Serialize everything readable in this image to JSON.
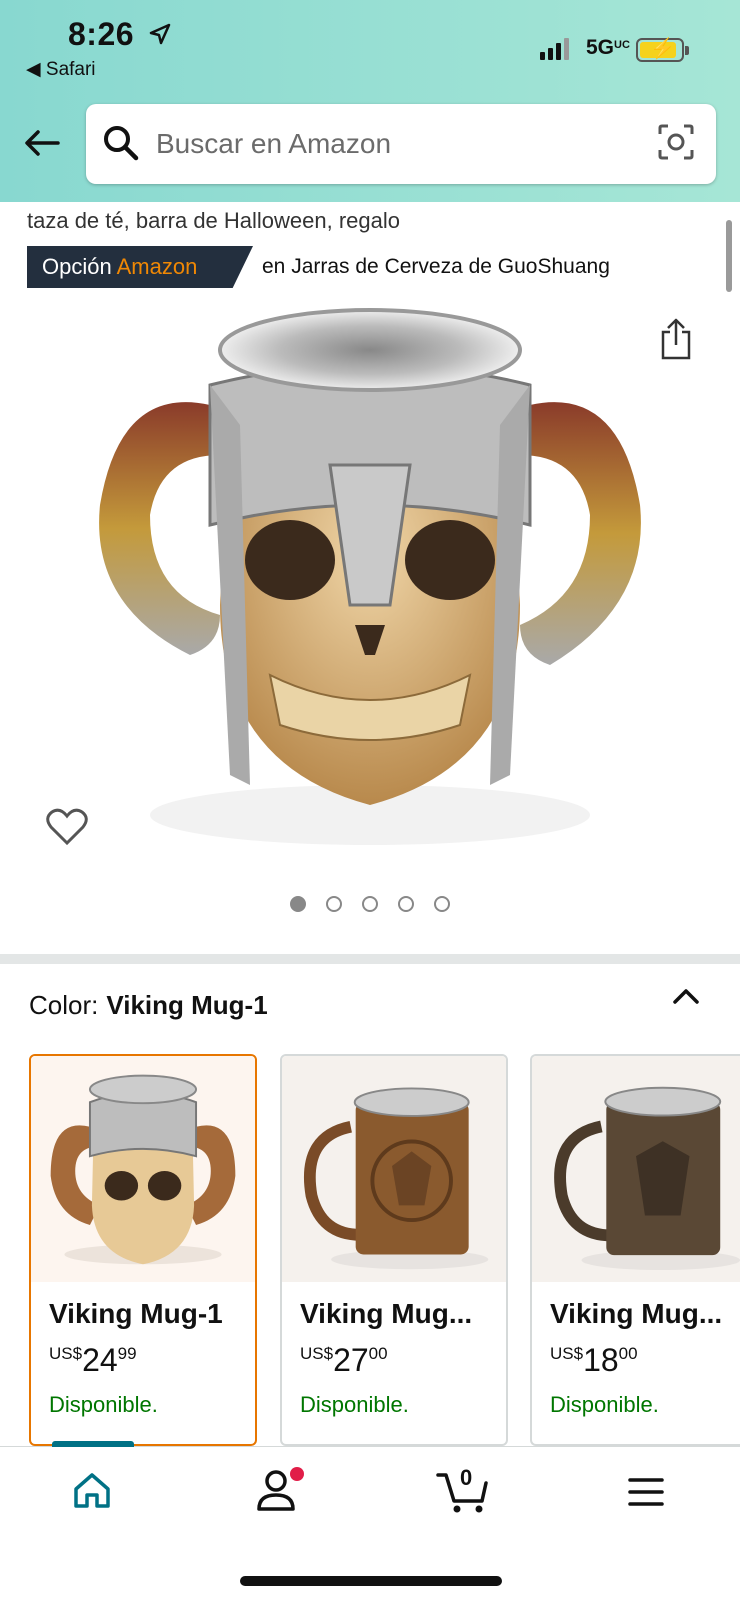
{
  "status_bar": {
    "time": "8:26",
    "back_app": "◀ Safari",
    "network": "5G",
    "network_suffix": "UC",
    "colors": {
      "battery": "#f5d21c"
    }
  },
  "search": {
    "placeholder": "Buscar en Amazon"
  },
  "product": {
    "title_fragment": "taza de té, barra de Halloween, regalo",
    "badge_prefix": "Opción",
    "badge_brand": "Amazon",
    "badge_description": "en Jarras de Cerveza de GuoShuang",
    "image_count": 5,
    "active_image": 1
  },
  "variation": {
    "label": "Color:",
    "selected": "Viking Mug-1"
  },
  "swatches": [
    {
      "name": "Viking Mug-1",
      "currency": "US$",
      "whole": "24",
      "fraction": "99",
      "availability": "Disponible."
    },
    {
      "name": "Viking Mug...",
      "currency": "US$",
      "whole": "27",
      "fraction": "00",
      "availability": "Disponible."
    },
    {
      "name": "Viking Mug...",
      "currency": "US$",
      "whole": "18",
      "fraction": "00",
      "availability": "Disponible."
    }
  ],
  "nav": {
    "cart_count": "0",
    "icons": [
      "home-icon",
      "account-icon",
      "cart-icon",
      "menu-icon"
    ],
    "colors": {
      "active": "#007185",
      "notification": "#e11d48"
    }
  },
  "colors": {
    "header_gradient_start": "#88d8d0",
    "badge_bg": "#232f3e",
    "brand_orange": "#f08804",
    "selected_border": "#e77600",
    "in_stock": "#007600"
  }
}
